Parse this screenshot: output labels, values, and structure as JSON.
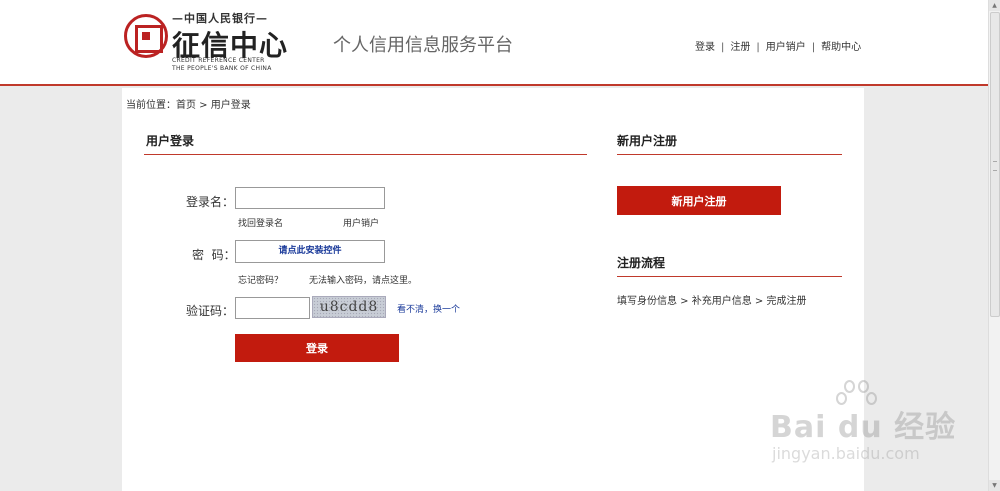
{
  "header": {
    "logo_top": "—中国人民银行—",
    "logo_main": "征信中心",
    "logo_en_line1": "CREDIT REFERENCE CENTER",
    "logo_en_line2": "THE PEOPLE'S BANK OF CHINA",
    "site_title": "个人信用信息服务平台",
    "nav": [
      "登录",
      "注册",
      "用户销户",
      "帮助中心"
    ],
    "nav_separator": "|"
  },
  "breadcrumb": {
    "prefix": "当前位置：",
    "home": "首页",
    "separator": " > ",
    "current": "用户登录"
  },
  "login": {
    "title": "用户登录",
    "username_label": "登录名：",
    "username_value": "",
    "find_username": "找回登录名",
    "deregister": "用户销户",
    "password_label": "密  码：",
    "plugin_prompt": "请点此安装控件",
    "forgot_password": "忘记密码？",
    "cannot_input": "无法输入密码，请点这里。",
    "captcha_label": "验证码：",
    "captcha_value": "",
    "captcha_image_text": "u8cdd8",
    "refresh_captcha": "看不清，换一个",
    "submit_label": "登录"
  },
  "register": {
    "title": "新用户注册",
    "button_label": "新用户注册"
  },
  "process": {
    "title": "注册流程",
    "steps": "填写身份信息  > 补充用户信息  > 完成注册"
  },
  "watermark": {
    "brand": "Bai du 经验",
    "url": "jingyan.baidu.com"
  },
  "colors": {
    "accent": "#c21b0e",
    "link_blue": "#1a3a9a"
  }
}
